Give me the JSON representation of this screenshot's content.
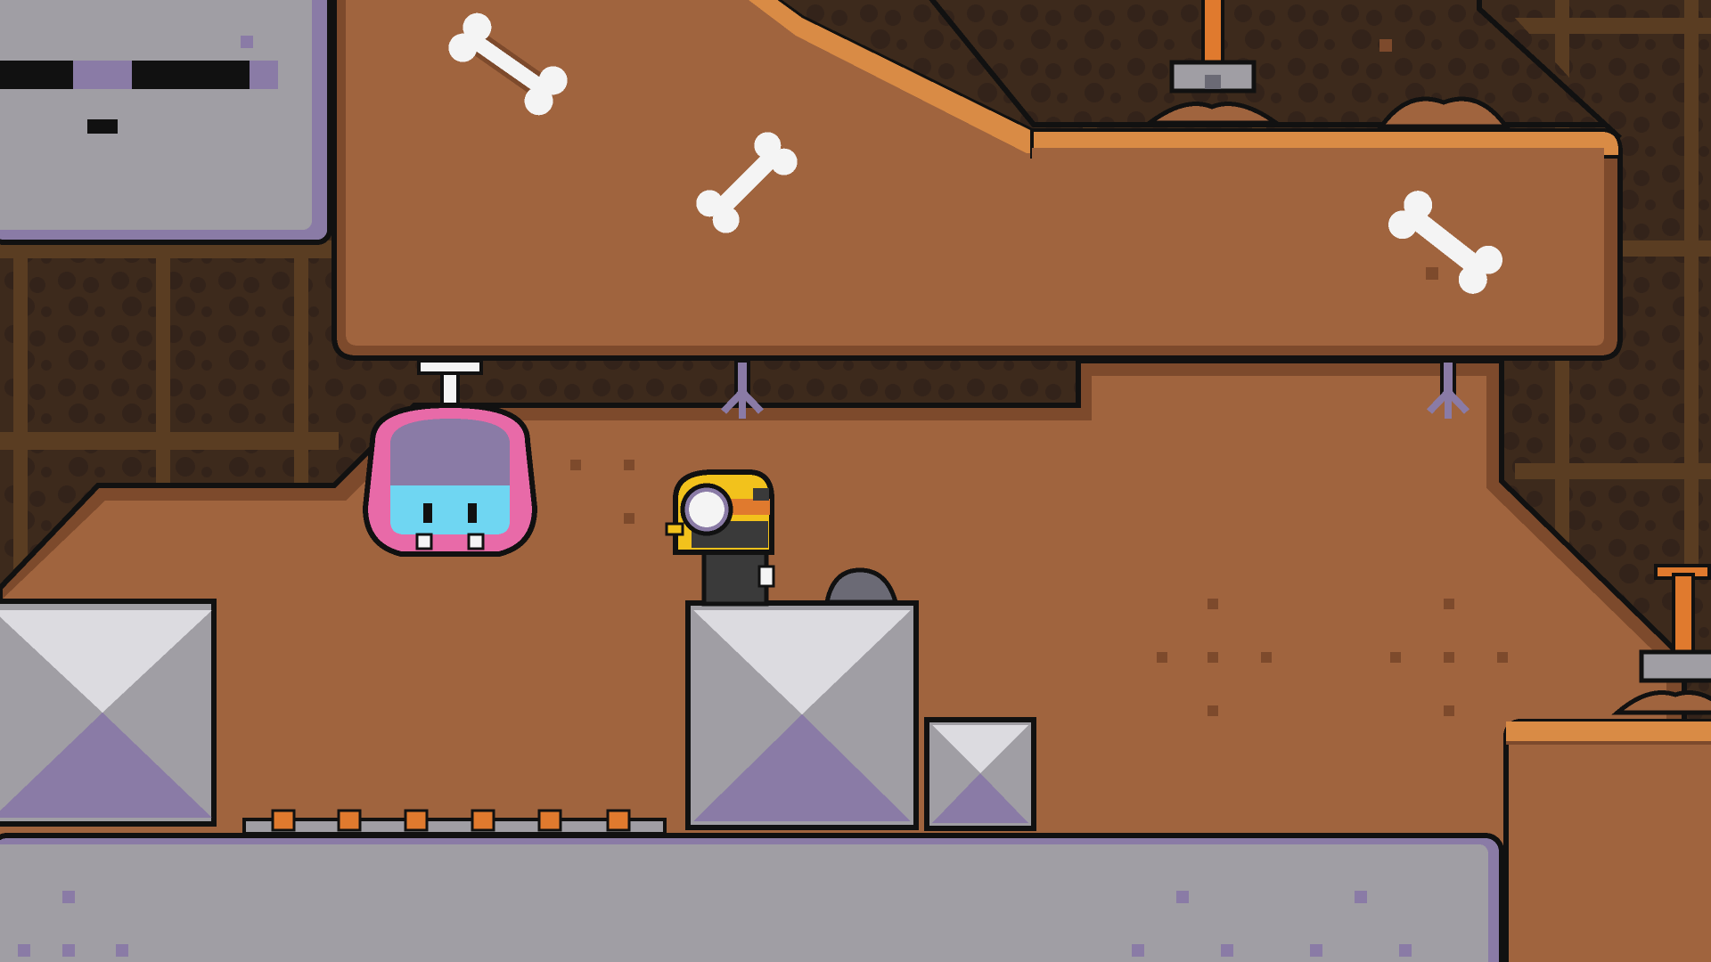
{
  "game": {
    "scene": "mine-level",
    "hud_visible": false
  },
  "palette": {
    "background_wall": "#3d2a1c",
    "background_beam": "#5a3d22",
    "dirt": "#a0643e",
    "dirt_dark": "#7d4a2c",
    "dirt_edge": "#d98b45",
    "stone_light": "#dcdbe0",
    "stone_mid": "#a09ea4",
    "stone_purple": "#8a7ba6",
    "outline": "#111111",
    "bone": "#f4f4f4",
    "player_helmet": "#f2c21c",
    "ghost_pink": "#e86aa8",
    "ghost_body": "#8a7ba6",
    "ghost_face": "#6fd6f2",
    "shovel_handle": "#e07a2e"
  },
  "entities": {
    "player": {
      "name": "miner-kid",
      "facing": "left"
    },
    "enemy": {
      "name": "hanging-ghost",
      "state": "hanging"
    },
    "collectibles": [
      {
        "type": "bone"
      },
      {
        "type": "bone"
      },
      {
        "type": "bone"
      }
    ],
    "props": [
      {
        "type": "shovel-in-dirt"
      },
      {
        "type": "shovel-in-dirt"
      },
      {
        "type": "pickaxe-hook"
      },
      {
        "type": "pickaxe-hook"
      }
    ],
    "hazards": [
      {
        "type": "spike-strip"
      }
    ]
  }
}
